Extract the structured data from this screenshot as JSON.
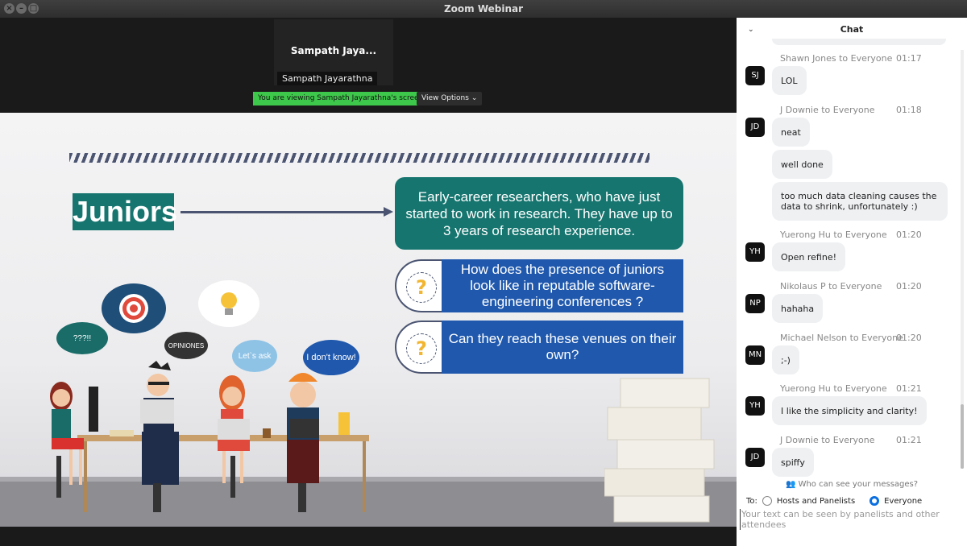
{
  "window": {
    "title": "Zoom Webinar"
  },
  "video": {
    "thumb_name": "Sampath Jaya...",
    "thumb_label": "Sampath Jayarathna",
    "viewing_text": "You are viewing Sampath Jayarathna's screen",
    "view_options": "View Options"
  },
  "slide": {
    "heading": "Juniors",
    "definition": "Early-career researchers, who have just started to work in research. They have up to 3 years of research experience.",
    "q1": "How does the presence of juniors look like in reputable software-engineering conferences ?",
    "q2": "Can they reach these venues on their own?",
    "q_mark": "?",
    "bubbles": [
      "???!!",
      "OPINIONES",
      "Let`s ask",
      "I don't know!"
    ]
  },
  "chat": {
    "title": "Chat",
    "messages": [
      {
        "sender": "Shawn Jones to Everyone",
        "time": "01:17",
        "initials": "SJ",
        "texts": [
          "LOL"
        ]
      },
      {
        "sender": "J Downie to Everyone",
        "time": "01:18",
        "initials": "JD",
        "texts": [
          "neat",
          "well done",
          "too much data cleaning causes the data to shrink, unfortunately :)"
        ]
      },
      {
        "sender": "Yuerong Hu to Everyone",
        "time": "01:20",
        "initials": "YH",
        "texts": [
          "Open refine!"
        ]
      },
      {
        "sender": "Nikolaus P to Everyone",
        "time": "01:20",
        "initials": "NP",
        "texts": [
          "hahaha"
        ]
      },
      {
        "sender": "Michael Nelson to Everyone",
        "time": "01:20",
        "initials": "MN",
        "texts": [
          ";-)"
        ]
      },
      {
        "sender": "Yuerong Hu to Everyone",
        "time": "01:21",
        "initials": "YH",
        "texts": [
          "I like the simplicity and clarity!"
        ]
      },
      {
        "sender": "J Downie to Everyone",
        "time": "01:21",
        "initials": "JD",
        "texts": [
          "spiffy"
        ]
      }
    ],
    "who_can_see": "Who can see your messages?",
    "to_label": "To:",
    "option_hosts": "Hosts and Panelists",
    "option_everyone": "Everyone",
    "input_placeholder": "Your text can be seen by panelists and other attendees"
  }
}
